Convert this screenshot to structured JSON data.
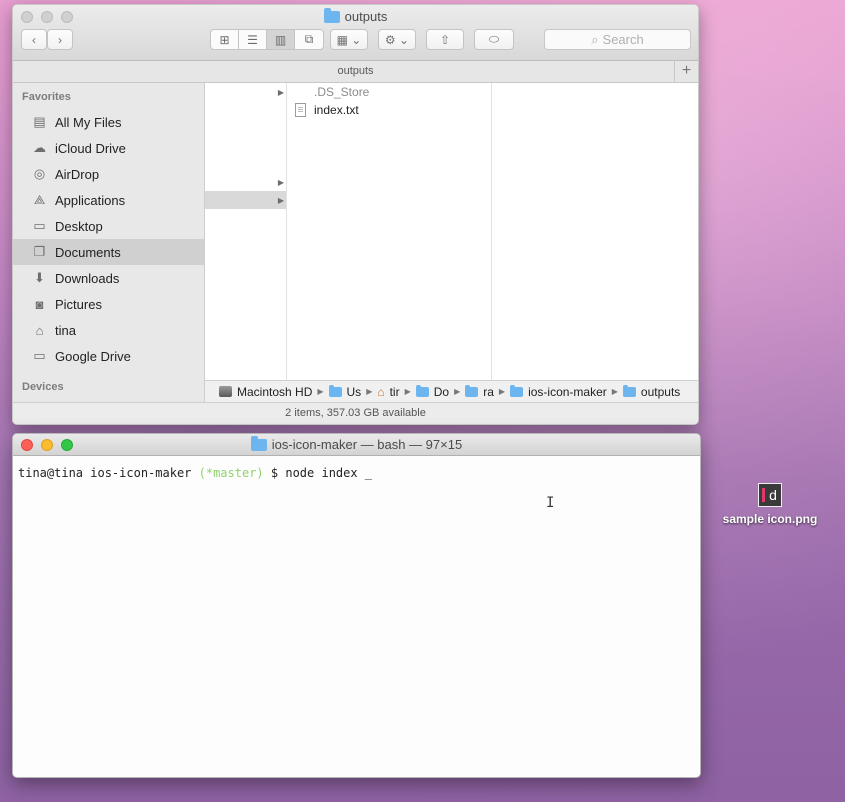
{
  "finder": {
    "window_title": "outputs",
    "tab_title": "outputs",
    "search_placeholder": "Search",
    "sidebar": {
      "favorites_header": "Favorites",
      "items": [
        {
          "label": "All My Files",
          "icon": "all-files-icon"
        },
        {
          "label": "iCloud Drive",
          "icon": "cloud-icon"
        },
        {
          "label": "AirDrop",
          "icon": "airdrop-icon"
        },
        {
          "label": "Applications",
          "icon": "applications-icon"
        },
        {
          "label": "Desktop",
          "icon": "desktop-icon"
        },
        {
          "label": "Documents",
          "icon": "documents-icon",
          "selected": true
        },
        {
          "label": "Downloads",
          "icon": "download-icon"
        },
        {
          "label": "Pictures",
          "icon": "camera-icon"
        },
        {
          "label": "tina",
          "icon": "home-icon"
        },
        {
          "label": "Google Drive",
          "icon": "folder-icon"
        }
      ],
      "devices_header": "Devices"
    },
    "files": [
      {
        "name": ".DS_Store",
        "hidden": true
      },
      {
        "name": "index.txt",
        "hidden": false
      }
    ],
    "path": [
      "Macintosh HD",
      "Us",
      "tir",
      "Do",
      "ra",
      "ios-icon-maker",
      "outputs"
    ],
    "status": "2 items, 357.03 GB available"
  },
  "terminal": {
    "title": "ios-icon-maker — bash — 97×15",
    "prompt": "tina@tina ios-icon-maker",
    "branch": "(*master)",
    "command": "$ node index _"
  },
  "desktop": {
    "icon_label": "sample icon.png",
    "thumb_letter": "d"
  },
  "colors": {
    "folder_blue": "#6db5ee",
    "git_branch_green": "#8fd26a",
    "close_red": "#fc5f57",
    "minimize_yellow": "#fdbc2e",
    "zoom_green": "#33c748"
  }
}
